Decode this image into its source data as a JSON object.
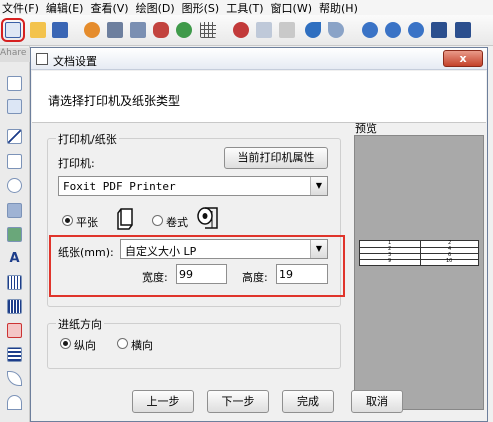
{
  "menu": [
    "文件(F)",
    "编辑(E)",
    "查看(V)",
    "绘图(D)",
    "图形(S)",
    "工具(T)",
    "窗口(W)",
    "帮助(H)"
  ],
  "toolbar": {
    "icons": [
      "document-setup-icon",
      "open-folder-icon",
      "save-icon",
      "settings-icon",
      "print-icon",
      "print-preview-icon",
      "database-icon",
      "connect-icon",
      "grid-icon",
      "cut-icon",
      "copy-icon",
      "paste-icon",
      "undo-icon",
      "redo-icon",
      "zoom-in-icon",
      "zoom-out-icon",
      "zoom-fit-icon",
      "fit-page-icon",
      "zoom-all-icon"
    ],
    "colors": {
      "active_outline": "#d62020"
    }
  },
  "left_tools": [
    "pointer-icon",
    "rotate-icon",
    "line-icon",
    "rectangle-icon",
    "ellipse-icon",
    "image-icon",
    "picture-icon",
    "text-icon",
    "barcode-icon",
    "barcode-2-icon",
    "shape-icon",
    "qrcode-icon",
    "curve-icon",
    "arc-icon"
  ],
  "doc_tab": "Ahare",
  "dialog": {
    "title": "文档设置",
    "close": "x",
    "instruction": "请选择打印机及纸张类型",
    "printer_group": {
      "legend": "打印机/纸张",
      "printer_label": "打印机:",
      "current_printer_button": "当前打印机属性",
      "printer_value": "Foxit PDF Printer",
      "sheet_label": "平张",
      "roll_label": "卷式"
    },
    "paper": {
      "label": "纸张(mm):",
      "value": "自定义大小 LP",
      "width_label": "宽度:",
      "width_value": "99",
      "height_label": "高度:",
      "height_value": "19"
    },
    "feed_group": {
      "legend": "进纸方向",
      "portrait": "纵向",
      "landscape": "横向"
    },
    "preview": {
      "legend": "预览",
      "labels_left": [
        "1",
        "2",
        "3",
        "9"
      ],
      "labels_right": [
        "2",
        "4",
        "6",
        "10"
      ]
    },
    "buttons": {
      "prev": "上一步",
      "next": "下一步",
      "finish": "完成",
      "cancel": "取消"
    },
    "colors": {
      "highlight": "#e0342b"
    }
  }
}
